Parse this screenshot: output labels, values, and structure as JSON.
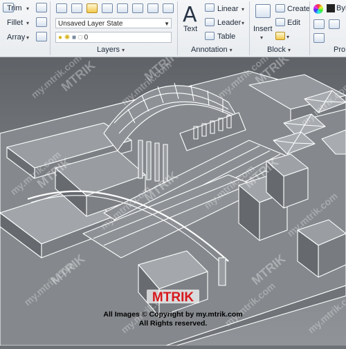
{
  "ribbon": {
    "modify": {
      "trim": "Trim",
      "fillet": "Fillet",
      "array": "Array"
    },
    "layers": {
      "layer_state": "Unsaved Layer State",
      "current_layer": "0",
      "panel_title": "Layers"
    },
    "annotation": {
      "text": "Text",
      "linear": "Linear",
      "leader": "Leader",
      "table": "Table",
      "panel_title": "Annotation"
    },
    "block": {
      "insert": "Insert",
      "create": "Create",
      "edit": "Edit",
      "panel_title": "Block"
    },
    "properties": {
      "bylayer": "ByL",
      "panel_title": "Pro"
    }
  },
  "watermark": {
    "brand": "MTRIK",
    "site": "my.mtrik.com",
    "copyright_line1": "All Images © Copyright by my.mtrik.com",
    "copyright_line2": "All Rights reserved."
  },
  "colors": {
    "ribbon_bg": "#f0f2f5",
    "viewport_bg": "#6e7276",
    "model_face": "#8a8e92",
    "edge": "#ffffff",
    "brand_red": "#d8181c"
  }
}
